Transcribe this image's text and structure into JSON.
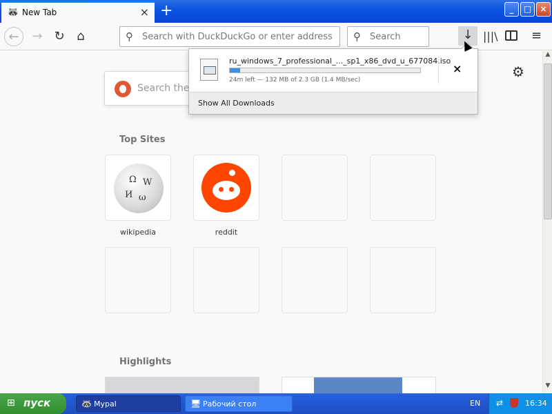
{
  "browser": {
    "tab_title": "New Tab",
    "tab_close": "×",
    "new_tab_symbol": "+",
    "window_controls": {
      "minimize": "_",
      "maximize": "□",
      "close": "×"
    }
  },
  "navbar": {
    "back": "←",
    "forward": "→",
    "reload": "↻",
    "home": "⌂",
    "url_placeholder": "Search with DuckDuckGo or enter address",
    "search_placeholder": "Search",
    "download_icon": "↓",
    "library_icon": "|||\\",
    "menu_icon": "≡"
  },
  "content": {
    "ddg_placeholder": "Search the",
    "top_sites_title": "Top Sites",
    "highlights_title": "Highlights",
    "top_sites": [
      {
        "label": "wikipedia"
      },
      {
        "label": "reddit"
      }
    ]
  },
  "downloads_panel": {
    "filename": "ru_windows_7_professional_..._sp1_x86_dvd_u_677084.iso",
    "status": "24m left — 132 MB of 2.3 GB (1.4 MB/sec)",
    "progress_percent": 5.6,
    "cancel": "×",
    "show_all": "Show All Downloads"
  },
  "taskbar": {
    "start_label": "пуск",
    "tasks": [
      {
        "label": "Mypal"
      },
      {
        "label": "Рабочий стол"
      }
    ],
    "language": "EN",
    "clock": "16:34"
  },
  "colors": {
    "accent": "#0a84ff",
    "progress": "#3b8fe8",
    "reddit": "#ff4500",
    "ddg": "#de5833"
  }
}
